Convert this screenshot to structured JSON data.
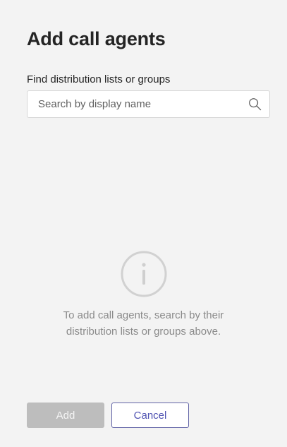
{
  "dialog": {
    "title": "Add call agents"
  },
  "search": {
    "label": "Find distribution lists or groups",
    "placeholder": "Search by display name",
    "value": "",
    "icon": "search-icon"
  },
  "empty_state": {
    "icon": "info-icon",
    "message": "To add call agents, search by their distribution lists or groups above."
  },
  "actions": {
    "add_label": "Add",
    "add_disabled": true,
    "cancel_label": "Cancel"
  },
  "colors": {
    "background": "#f3f3f3",
    "accent": "#6264a7",
    "disabled": "#bdbdbd"
  }
}
